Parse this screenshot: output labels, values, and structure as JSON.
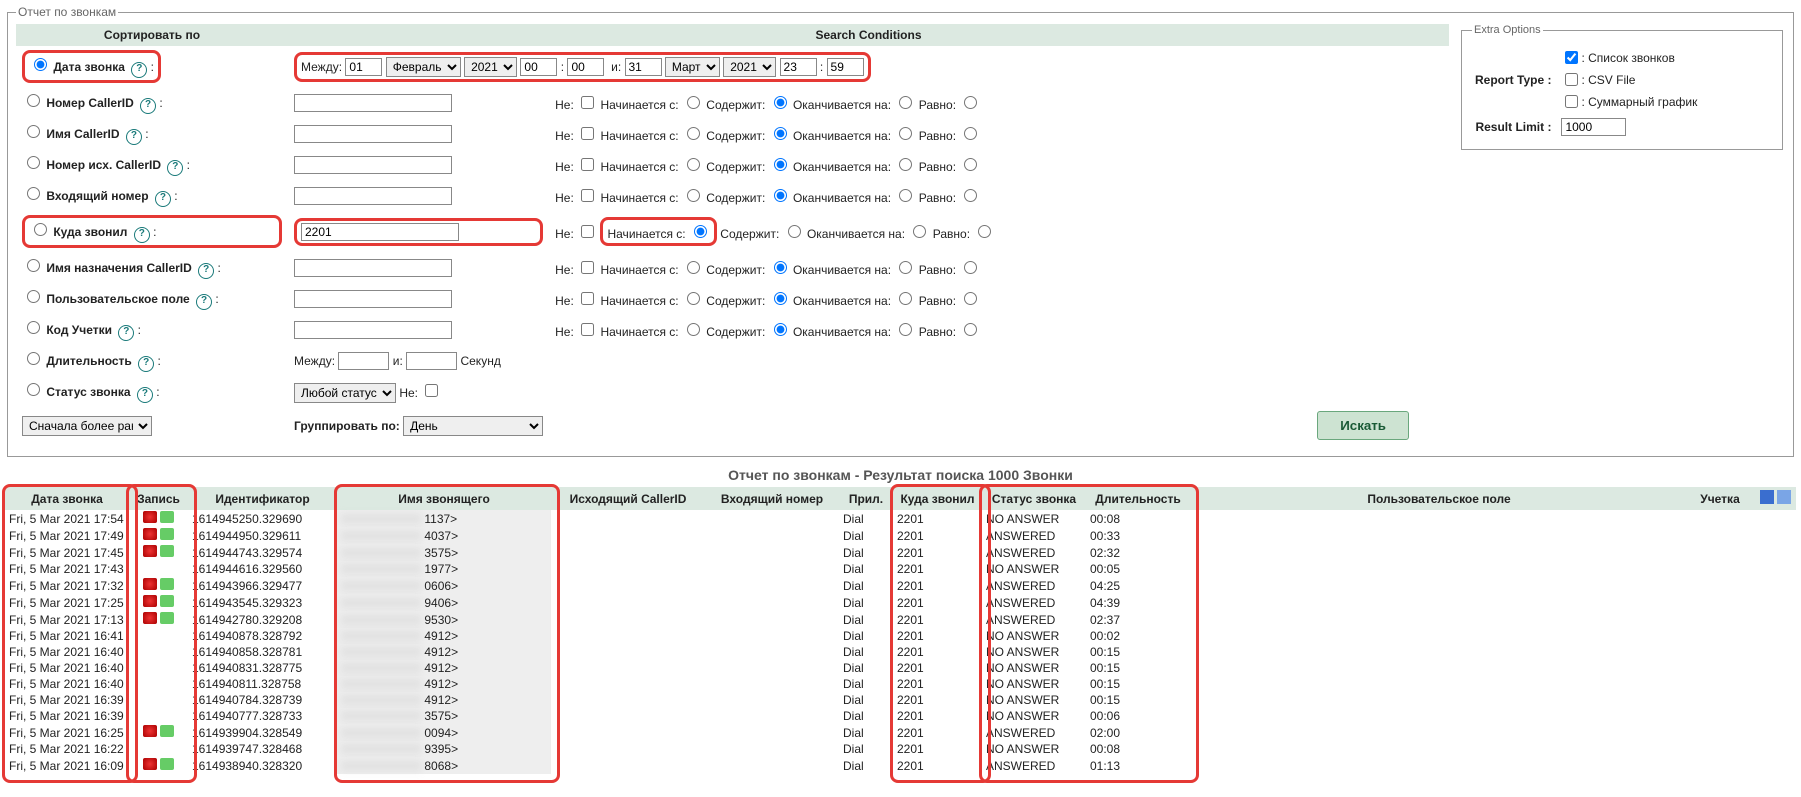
{
  "legend": "Отчет по звонкам",
  "headers": {
    "sort": "Сортировать по",
    "cond": "Search Conditions"
  },
  "between": "Между:",
  "and": "и:",
  "seconds": "Секунд",
  "ne": "Не:",
  "starts": "Начинается с:",
  "contains": "Содержит:",
  "ends": "Оканчивается на:",
  "equals": "Равно:",
  "dateFrom": {
    "day": "01",
    "month": "Февраль",
    "year": "2021",
    "h": "00",
    "m": "00"
  },
  "dateTo": {
    "day": "31",
    "month": "Март",
    "year": "2021",
    "h": "23",
    "m": "59"
  },
  "rows": {
    "date": "Дата звонка",
    "callerIdNum": "Номер CallerID",
    "callerIdName": "Имя CallerID",
    "outCallerId": "Номер исх. CallerID",
    "inNum": "Входящий номер",
    "dst": "Куда звонил",
    "dstName": "Имя назначения CallerID",
    "userField": "Пользовательское поле",
    "acct": "Код Учетки",
    "duration": "Длительность",
    "status": "Статус звонка"
  },
  "dstValue": "2201",
  "statusSelect": "Любой статус",
  "orderSelect": "Сначала более ранние",
  "groupBy": "Группировать по:",
  "groupByVal": "День",
  "searchBtn": "Искать",
  "extra": {
    "legend": "Extra Options",
    "reportType": "Report Type :",
    "opt1": ": Список звонков",
    "opt2": ": CSV File",
    "opt3": ": Суммарный график",
    "limitLbl": "Result Limit :",
    "limitVal": "1000"
  },
  "resultTitle": "Отчет по звонкам - Результат поиска 1000 Звонки",
  "resHeaders": {
    "date": "Дата звонка",
    "rec": "Запись",
    "id": "Идентификатор",
    "callerName": "Имя звонящего",
    "outCid": "Исходящий CallerID",
    "inNum": "Входящий номер",
    "app": "Прил.",
    "dst": "Куда звонил",
    "status": "Статус звонка",
    "dur": "Длительность",
    "userField": "Пользовательское поле",
    "acct": "Учетка"
  },
  "results": [
    {
      "date": "Fri, 5 Mar 2021 17:54",
      "rec": true,
      "id": "1614945250.329690",
      "cn": "1137>",
      "app": "Dial",
      "dst": "2201",
      "status": "NO ANSWER",
      "dur": "00:08"
    },
    {
      "date": "Fri, 5 Mar 2021 17:49",
      "rec": true,
      "id": "1614944950.329611",
      "cn": "4037>",
      "app": "Dial",
      "dst": "2201",
      "status": "ANSWERED",
      "dur": "00:33"
    },
    {
      "date": "Fri, 5 Mar 2021 17:45",
      "rec": true,
      "id": "1614944743.329574",
      "cn": "3575>",
      "app": "Dial",
      "dst": "2201",
      "status": "ANSWERED",
      "dur": "02:32"
    },
    {
      "date": "Fri, 5 Mar 2021 17:43",
      "rec": false,
      "id": "1614944616.329560",
      "cn": "1977>",
      "app": "Dial",
      "dst": "2201",
      "status": "NO ANSWER",
      "dur": "00:05"
    },
    {
      "date": "Fri, 5 Mar 2021 17:32",
      "rec": true,
      "id": "1614943966.329477",
      "cn": "0606>",
      "app": "Dial",
      "dst": "2201",
      "status": "ANSWERED",
      "dur": "04:25"
    },
    {
      "date": "Fri, 5 Mar 2021 17:25",
      "rec": true,
      "id": "1614943545.329323",
      "cn": "9406>",
      "app": "Dial",
      "dst": "2201",
      "status": "ANSWERED",
      "dur": "04:39"
    },
    {
      "date": "Fri, 5 Mar 2021 17:13",
      "rec": true,
      "id": "1614942780.329208",
      "cn": "9530>",
      "app": "Dial",
      "dst": "2201",
      "status": "ANSWERED",
      "dur": "02:37"
    },
    {
      "date": "Fri, 5 Mar 2021 16:41",
      "rec": false,
      "id": "1614940878.328792",
      "cn": "4912>",
      "app": "Dial",
      "dst": "2201",
      "status": "NO ANSWER",
      "dur": "00:02"
    },
    {
      "date": "Fri, 5 Mar 2021 16:40",
      "rec": false,
      "id": "1614940858.328781",
      "cn": "4912>",
      "app": "Dial",
      "dst": "2201",
      "status": "NO ANSWER",
      "dur": "00:15"
    },
    {
      "date": "Fri, 5 Mar 2021 16:40",
      "rec": false,
      "id": "1614940831.328775",
      "cn": "4912>",
      "app": "Dial",
      "dst": "2201",
      "status": "NO ANSWER",
      "dur": "00:15"
    },
    {
      "date": "Fri, 5 Mar 2021 16:40",
      "rec": false,
      "id": "1614940811.328758",
      "cn": "4912>",
      "app": "Dial",
      "dst": "2201",
      "status": "NO ANSWER",
      "dur": "00:15"
    },
    {
      "date": "Fri, 5 Mar 2021 16:39",
      "rec": false,
      "id": "1614940784.328739",
      "cn": "4912>",
      "app": "Dial",
      "dst": "2201",
      "status": "NO ANSWER",
      "dur": "00:15"
    },
    {
      "date": "Fri, 5 Mar 2021 16:39",
      "rec": false,
      "id": "1614940777.328733",
      "cn": "3575>",
      "app": "Dial",
      "dst": "2201",
      "status": "NO ANSWER",
      "dur": "00:06"
    },
    {
      "date": "Fri, 5 Mar 2021 16:25",
      "rec": true,
      "id": "1614939904.328549",
      "cn": "0094>",
      "app": "Dial",
      "dst": "2201",
      "status": "ANSWERED",
      "dur": "02:00"
    },
    {
      "date": "Fri, 5 Mar 2021 16:22",
      "rec": false,
      "id": "1614939747.328468",
      "cn": "9395>",
      "app": "Dial",
      "dst": "2201",
      "status": "NO ANSWER",
      "dur": "00:08"
    },
    {
      "date": "Fri, 5 Mar 2021 16:09",
      "rec": true,
      "id": "1614938940.328320",
      "cn": "8068>",
      "app": "Dial",
      "dst": "2201",
      "status": "ANSWERED",
      "dur": "01:13"
    }
  ]
}
